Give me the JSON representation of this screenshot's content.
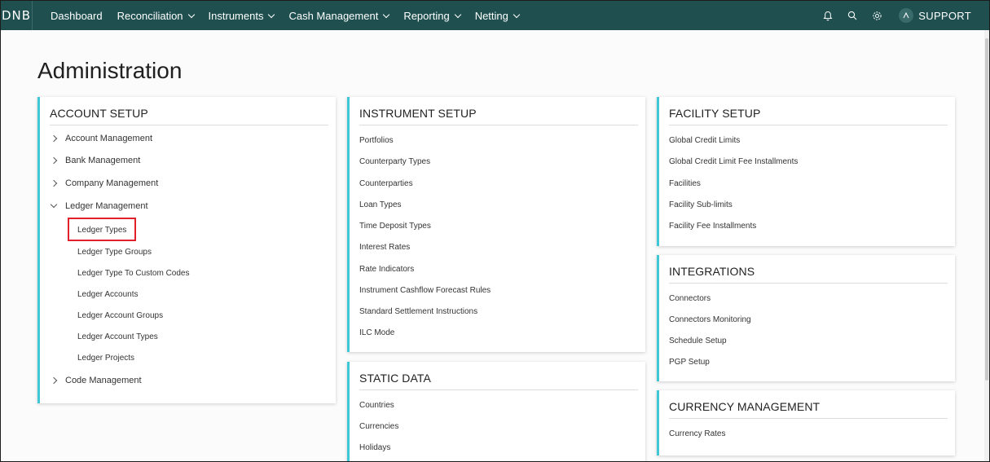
{
  "logo": "DNB",
  "nav": {
    "items": [
      {
        "label": "Dashboard",
        "dropdown": false
      },
      {
        "label": "Reconciliation",
        "dropdown": true
      },
      {
        "label": "Instruments",
        "dropdown": true
      },
      {
        "label": "Cash Management",
        "dropdown": true
      },
      {
        "label": "Reporting",
        "dropdown": true
      },
      {
        "label": "Netting",
        "dropdown": true
      }
    ],
    "user": "SUPPORT",
    "icons": [
      "bell-icon",
      "search-icon",
      "gear-icon",
      "user-icon"
    ]
  },
  "page": {
    "title": "Administration"
  },
  "account_setup": {
    "title": "ACCOUNT SETUP",
    "groups": [
      {
        "label": "Account Management",
        "expanded": false
      },
      {
        "label": "Bank Management",
        "expanded": false
      },
      {
        "label": "Company Management",
        "expanded": false
      },
      {
        "label": "Ledger Management",
        "expanded": true
      },
      {
        "label": "Code Management",
        "expanded": false
      }
    ],
    "ledger_items": [
      "Ledger Types",
      "Ledger Type Groups",
      "Ledger Type To Custom Codes",
      "Ledger Accounts",
      "Ledger Account Groups",
      "Ledger Account Types",
      "Ledger Projects"
    ]
  },
  "instrument_setup": {
    "title": "INSTRUMENT SETUP",
    "items": [
      "Portfolios",
      "Counterparty Types",
      "Counterparties",
      "Loan Types",
      "Time Deposit Types",
      "Interest Rates",
      "Rate Indicators",
      "Instrument Cashflow Forecast Rules",
      "Standard Settlement Instructions",
      "ILC Mode"
    ]
  },
  "static_data": {
    "title": "STATIC DATA",
    "items": [
      "Countries",
      "Currencies",
      "Holidays"
    ]
  },
  "facility_setup": {
    "title": "FACILITY SETUP",
    "items": [
      "Global Credit Limits",
      "Global Credit Limit Fee Installments",
      "Facilities",
      "Facility Sub-limits",
      "Facility Fee Installments"
    ]
  },
  "integrations": {
    "title": "INTEGRATIONS",
    "items": [
      "Connectors",
      "Connectors Monitoring",
      "Schedule Setup",
      "PGP Setup"
    ]
  },
  "currency_management": {
    "title": "CURRENCY MANAGEMENT",
    "items": [
      "Currency Rates"
    ]
  },
  "colors": {
    "topbar": "#1f4f4f",
    "card_accent": "#3ec8d6",
    "highlight": "#e0212b"
  }
}
